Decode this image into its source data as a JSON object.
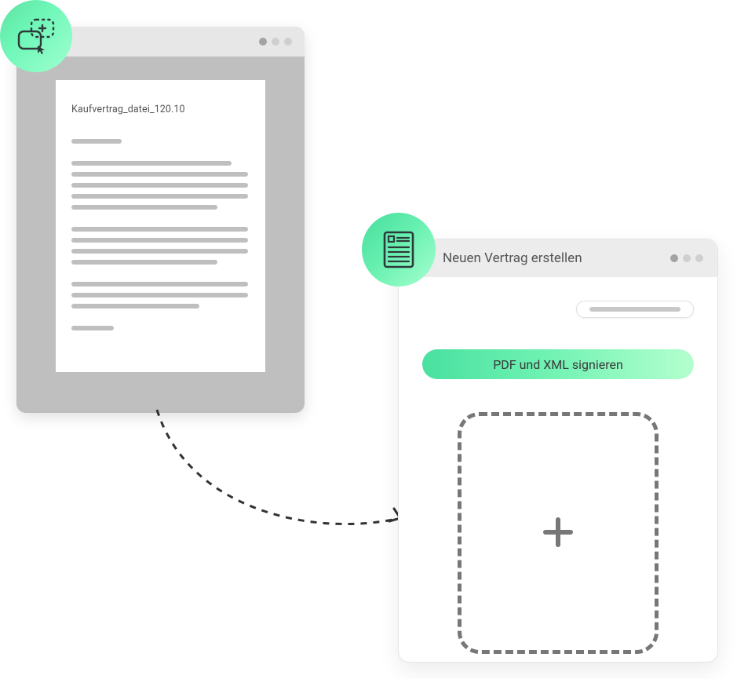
{
  "document": {
    "filename": "Kaufvertrag_datei_120.10"
  },
  "app": {
    "title": "Neuen Vertrag erstellen",
    "sign_button_label": "PDF und XML signieren"
  }
}
